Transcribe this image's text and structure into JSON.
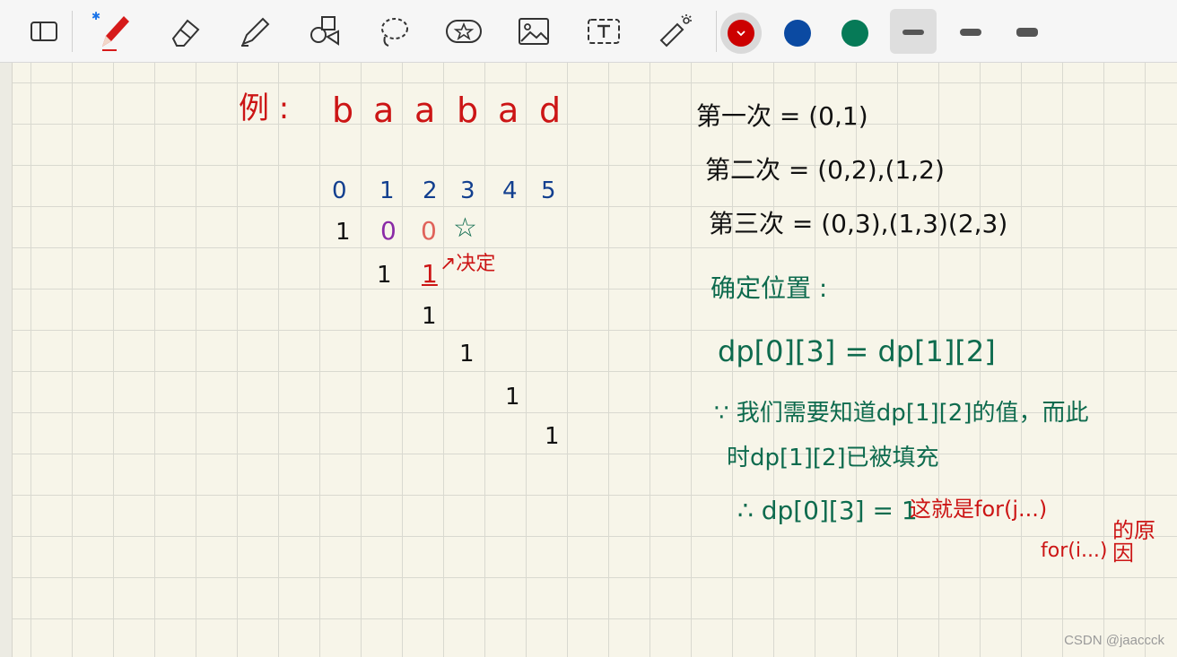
{
  "toolbar": {
    "tools": [
      {
        "name": "page-layout",
        "icon": "page-layout-icon"
      },
      {
        "name": "pen",
        "icon": "pen-icon"
      },
      {
        "name": "eraser",
        "icon": "eraser-icon"
      },
      {
        "name": "highlighter",
        "icon": "highlighter-icon"
      },
      {
        "name": "shapes",
        "icon": "shapes-icon"
      },
      {
        "name": "lasso",
        "icon": "lasso-icon"
      },
      {
        "name": "sticker",
        "icon": "sticker-icon"
      },
      {
        "name": "image",
        "icon": "image-icon"
      },
      {
        "name": "text",
        "icon": "text-box-icon"
      },
      {
        "name": "laser",
        "icon": "laser-pointer-icon"
      }
    ],
    "colors": [
      "#cc0000",
      "#0b4aa2",
      "#067a57"
    ],
    "selected_color": "#cc0000",
    "selected_stroke": 1
  },
  "notes": {
    "example_label": "例 :",
    "string_chars": [
      "b",
      "a",
      "a",
      "b",
      "a",
      "d"
    ],
    "index_row": [
      "0",
      "1",
      "2",
      "3",
      "4",
      "5"
    ],
    "row0": [
      "1",
      "0",
      "0",
      "☆"
    ],
    "row1_one": "1",
    "row1_decision": "1",
    "decision_text": "↗决定",
    "diag_ones": [
      "1",
      "1",
      "1",
      "1"
    ],
    "right_first": "第一次 = (0,1)",
    "right_second": "第二次 = (0,2),(1,2)",
    "right_third": "第三次 = (0,3),(1,3)(2,3)",
    "right_position": "确定位置 :",
    "right_eq": "dp[0][3] = dp[1][2]",
    "right_reason1": "∵ 我们需要知道dp[1][2]的值，而此",
    "right_reason2": "时dp[1][2]已被填充",
    "right_result": "∴ dp[0][3] = 1",
    "right_result_note": "这就是for(j...)",
    "right_for": "for(i...)",
    "right_reason_tail": "的原因"
  },
  "watermark": "CSDN @jaaccck"
}
